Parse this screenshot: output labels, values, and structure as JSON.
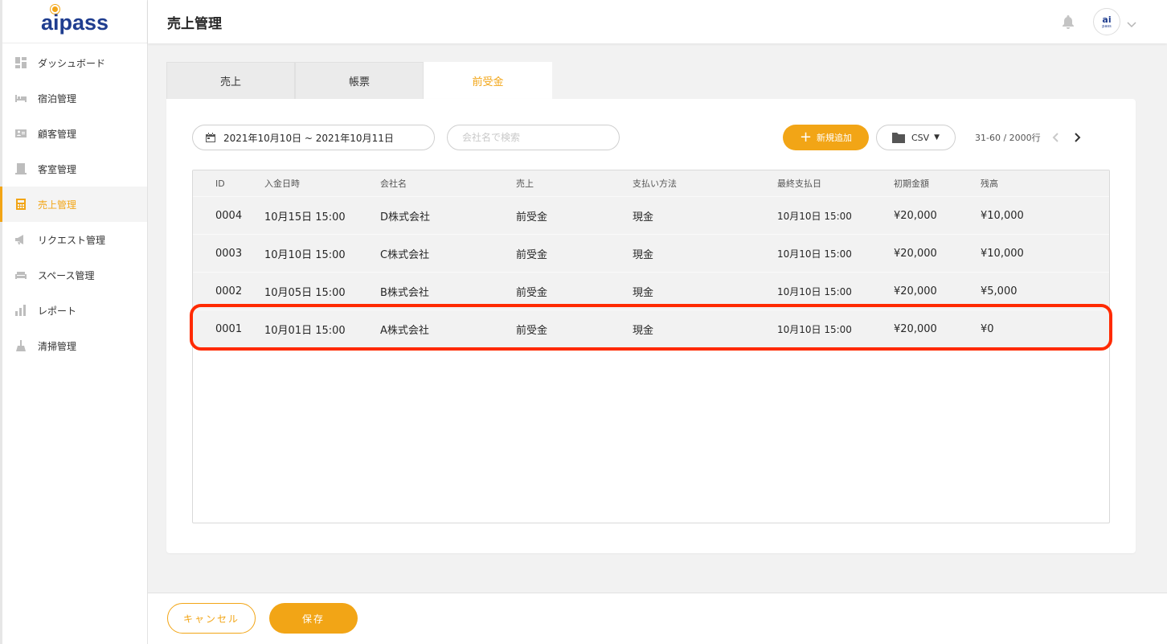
{
  "app": {
    "logo_text": "aipass",
    "avatar_text": "ai",
    "avatar_sub": "pass"
  },
  "header": {
    "title": "売上管理"
  },
  "sidebar": {
    "items": [
      {
        "label": "ダッシュボード",
        "icon": "dashboard-icon",
        "active": false
      },
      {
        "label": "宿泊管理",
        "icon": "bed-icon",
        "active": false
      },
      {
        "label": "顧客管理",
        "icon": "id-card-icon",
        "active": false
      },
      {
        "label": "客室管理",
        "icon": "door-icon",
        "active": false
      },
      {
        "label": "売上管理",
        "icon": "calculator-icon",
        "active": true
      },
      {
        "label": "リクエスト管理",
        "icon": "megaphone-icon",
        "active": false
      },
      {
        "label": "スペース管理",
        "icon": "sofa-icon",
        "active": false
      },
      {
        "label": "レポート",
        "icon": "bar-chart-icon",
        "active": false
      },
      {
        "label": "清掃管理",
        "icon": "broom-icon",
        "active": false
      }
    ]
  },
  "tabs": [
    {
      "label": "売上",
      "active": false
    },
    {
      "label": "帳票",
      "active": false
    },
    {
      "label": "前受金",
      "active": true
    }
  ],
  "toolbar": {
    "date_range": "2021年10月10日 ~ 2021年10月11日",
    "search_placeholder": "会社名で検索",
    "add_label": "新規追加",
    "csv_label": "CSV",
    "pager_text": "31-60 / 2000行"
  },
  "table": {
    "columns": [
      "ID",
      "入金日時",
      "会社名",
      "売上",
      "支払い方法",
      "最終支払日",
      "初期金額",
      "残高"
    ],
    "rows": [
      [
        "0004",
        "10月15日 15:00",
        "D株式会社",
        "前受金",
        "現金",
        "10月10日 15:00",
        "¥20,000",
        "¥10,000"
      ],
      [
        "0003",
        "10月10日 15:00",
        "C株式会社",
        "前受金",
        "現金",
        "10月10日 15:00",
        "¥20,000",
        "¥10,000"
      ],
      [
        "0002",
        "10月05日 15:00",
        "B株式会社",
        "前受金",
        "現金",
        "10月10日 15:00",
        "¥20,000",
        "¥5,000"
      ],
      [
        "0001",
        "10月01日 15:00",
        "A株式会社",
        "前受金",
        "現金",
        "10月10日 15:00",
        "¥20,000",
        "¥0"
      ]
    ],
    "highlighted_row_id": "0001"
  },
  "footer": {
    "cancel_label": "キャンセル",
    "save_label": "保存"
  },
  "colors": {
    "accent": "#f2a516",
    "brand": "#1f3d8f",
    "highlight": "#ff2a00"
  }
}
